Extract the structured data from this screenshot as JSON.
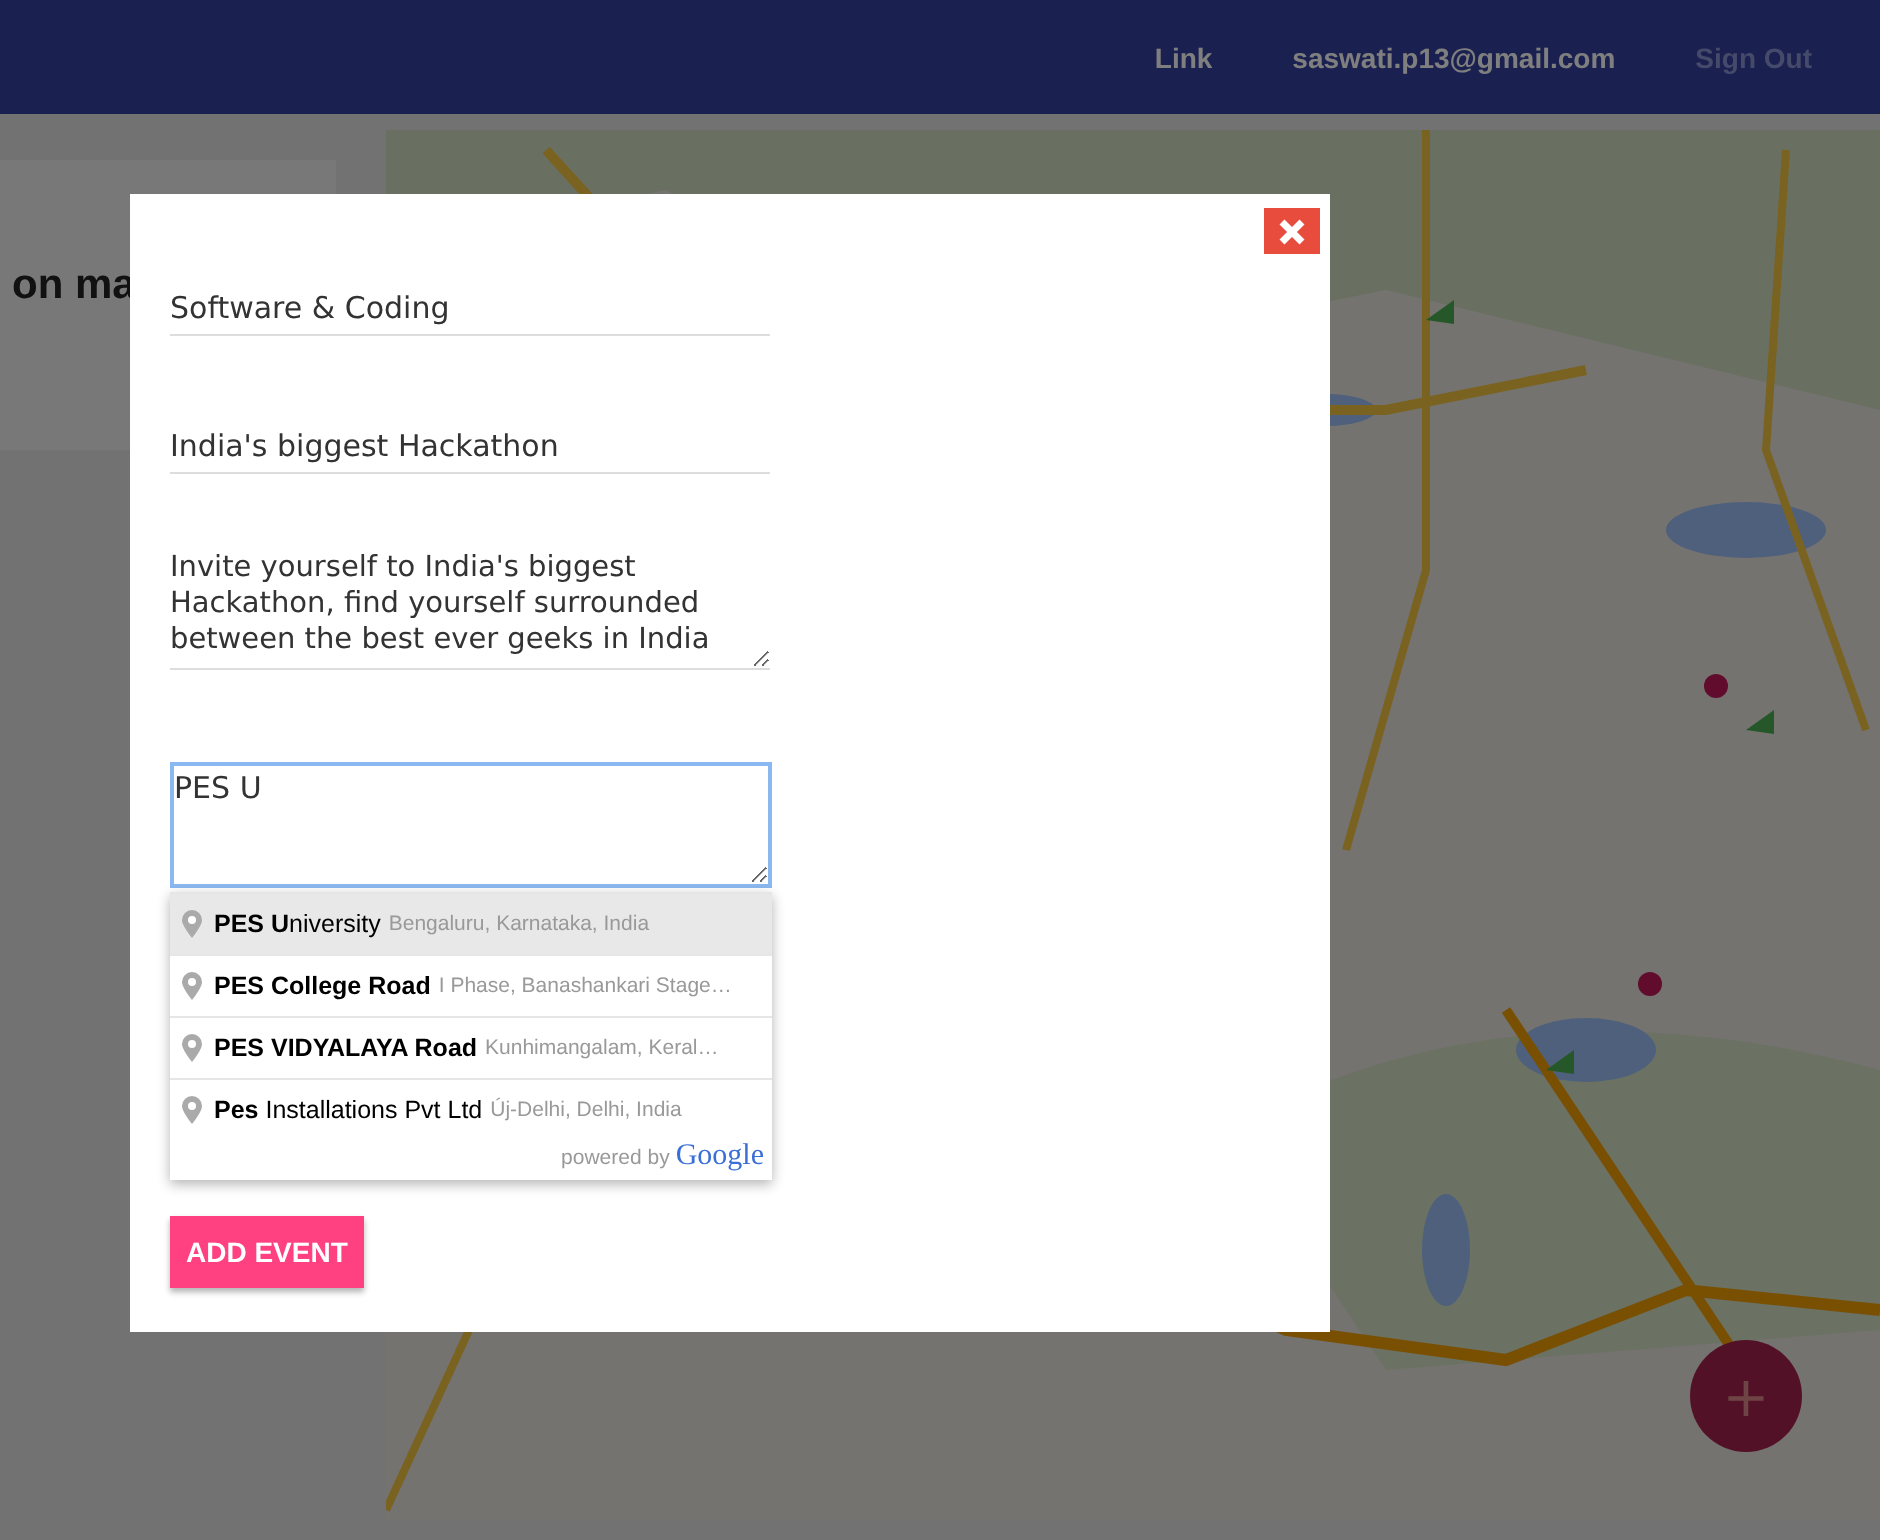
{
  "navbar": {
    "links": [
      {
        "label": "Link",
        "muted": false
      },
      {
        "label": "saswati.p13@gmail.com",
        "muted": false
      },
      {
        "label": "Sign Out",
        "muted": true
      }
    ]
  },
  "side_panel": {
    "heading": "on ma"
  },
  "modal": {
    "fields": [
      {
        "kind": "line",
        "value": "Software & Coding",
        "focused": false
      },
      {
        "kind": "line",
        "value": "India's biggest Hackathon",
        "focused": false
      },
      {
        "kind": "area",
        "value": "Invite yourself to India's biggest Hackathon, find yourself surrounded between the best ever geeks in India",
        "focused": false
      },
      {
        "kind": "area",
        "value": "PES U",
        "focused": true
      }
    ],
    "suggestions": [
      {
        "main": "**PES U**niversity",
        "secondary": "Bengaluru, Karnataka, India",
        "selected": true
      },
      {
        "main": "**PES College Road**",
        "secondary": "I Phase, Banashankari Stage…",
        "selected": false
      },
      {
        "main": "**PES VIDYALAYA Road**",
        "secondary": "Kunhimangalam, Keral…",
        "selected": false
      },
      {
        "main": "**Pes** Installations Pvt Ltd",
        "secondary": "Új-Delhi, Delhi, India",
        "selected": false
      }
    ],
    "attribution": {
      "prefix": "powered by",
      "brand": "Google"
    },
    "submit": "ADD EVENT"
  },
  "fab": {
    "label": "+"
  }
}
